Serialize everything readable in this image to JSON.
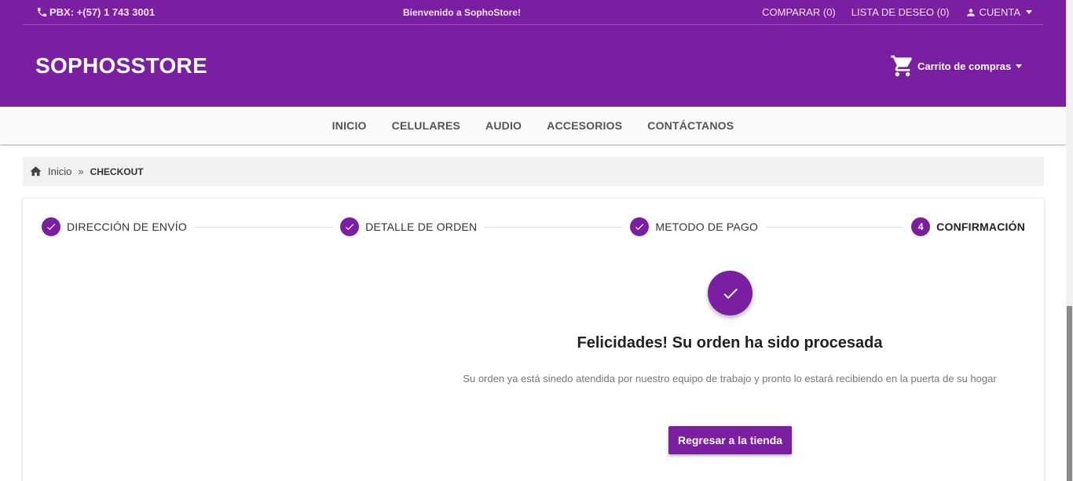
{
  "topbar": {
    "phone": "PBX: +(57) 1 743 3001",
    "welcome": "Bienvenido a SophoStore!",
    "compare": "COMPARAR (0)",
    "wishlist": "LISTA DE DESEO (0)",
    "account": "CUENTA"
  },
  "header": {
    "brand": "SOPHOSSTORE",
    "cart": "Carrito de compras"
  },
  "nav": {
    "items": [
      "INICIO",
      "CELULARES",
      "AUDIO",
      "ACCESORIOS",
      "CONTÁCTANOS"
    ]
  },
  "breadcrumb": {
    "home": "Inicio",
    "separator": "»",
    "current": "CHECKOUT"
  },
  "stepper": {
    "steps": [
      {
        "label": "DIRECCIÓN DE ENVÍO",
        "state": "done"
      },
      {
        "label": "DETALLE DE ORDEN",
        "state": "done"
      },
      {
        "label": "METODO DE PAGO",
        "state": "done"
      },
      {
        "label": "CONFIRMACIÓN",
        "state": "active",
        "number": "4"
      }
    ]
  },
  "confirmation": {
    "title": "Felicidades! Su orden ha sido procesada",
    "message": "Su orden ya está sinedo atendida por nuestro equipo de trabajo y pronto lo estará recibiendo en la puerta de su hogar",
    "button": "Regresar a la tienda"
  },
  "colors": {
    "primary": "#7b1fa2",
    "navbar_bg": "#fafafa",
    "breadcrumb_bg": "#f1f1f1"
  }
}
